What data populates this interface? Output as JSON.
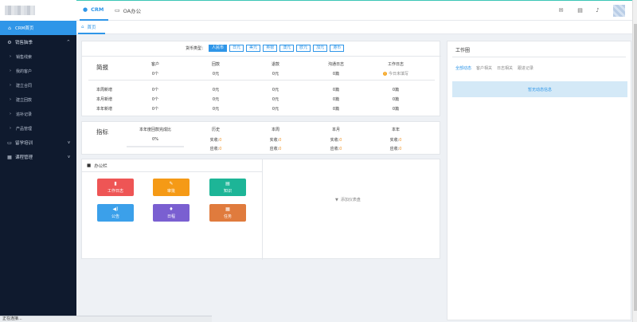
{
  "header": {
    "apps": [
      {
        "label": "CRM",
        "icon": "cloud-icon"
      },
      {
        "label": "OA办公",
        "icon": "monitor-icon"
      }
    ]
  },
  "breadcrumb": {
    "home": "首页"
  },
  "sidebar": {
    "items": [
      {
        "label": "CRM首页",
        "icon": "home-icon",
        "active": true
      },
      {
        "label": "销售脑季",
        "icon": "gear-icon",
        "expandable": true
      },
      {
        "label": "销售线索"
      },
      {
        "label": "我的客户"
      },
      {
        "label": "建立合同"
      },
      {
        "label": "建立回款"
      },
      {
        "label": "追补记录"
      },
      {
        "label": "产品管理"
      },
      {
        "label": "留学培训",
        "icon": "book-icon",
        "expandable": true
      },
      {
        "label": "课程管理",
        "icon": "grid-icon",
        "expandable": true
      }
    ]
  },
  "status_bar": {
    "text": "正在连接..."
  },
  "summary": {
    "currency_label": "货币类型：",
    "currencies": [
      "人民币",
      "日元",
      "美元",
      "英镑",
      "澳元",
      "欧元",
      "加元",
      "港币"
    ],
    "selected_currency": "人民币",
    "title": "简报",
    "columns": [
      "客户",
      "回款",
      "退款",
      "沟通日志",
      "工作日志"
    ],
    "totals": [
      "0个",
      "0元",
      "0元",
      "0篇",
      "今日未填写"
    ],
    "rows": [
      {
        "label": "本周新增",
        "values": [
          "0个",
          "0元",
          "0元",
          "0篇",
          "0篇"
        ]
      },
      {
        "label": "本月新增",
        "values": [
          "0个",
          "0元",
          "0元",
          "0篇",
          "0篇"
        ]
      },
      {
        "label": "本年新增",
        "values": [
          "0个",
          "0元",
          "0元",
          "0篇",
          "0篇"
        ]
      }
    ]
  },
  "indicators": {
    "title": "指标",
    "completion_label": "本年度回款完成比",
    "completion_value": "0%",
    "completion_fraction": 0,
    "columns": [
      "历史",
      "本周",
      "本月",
      "本年"
    ],
    "actual_label": "实收:",
    "due_label": "应收:",
    "actual_value": "0",
    "due_value": "0"
  },
  "office": {
    "title": "办公栏",
    "tiles": [
      {
        "label": "工作日志",
        "icon": "book-icon",
        "color": "#ee5555"
      },
      {
        "label": "审批",
        "icon": "edit-icon",
        "color": "#f59a16"
      },
      {
        "label": "知识",
        "icon": "document-icon",
        "color": "#1db597"
      },
      {
        "label": "公告",
        "icon": "speaker-icon",
        "color": "#3ba0ea"
      },
      {
        "label": "日程",
        "icon": "pin-icon",
        "color": "#7a5fd1"
      },
      {
        "label": "任务",
        "icon": "calendar-icon",
        "color": "#e07b3d"
      }
    ],
    "add_dashboard": "添加仪表盘"
  },
  "workbench": {
    "title": "工作圈",
    "tabs": [
      "全部动态",
      "客户相关",
      "日志相关",
      "跟进记录"
    ],
    "active_tab": "全部动态",
    "empty_text": "暂无动态信息"
  },
  "colors": {
    "accent": "#2f96e8",
    "sidebar_bg": "#0f1a2e",
    "orange": "#f0962c"
  }
}
